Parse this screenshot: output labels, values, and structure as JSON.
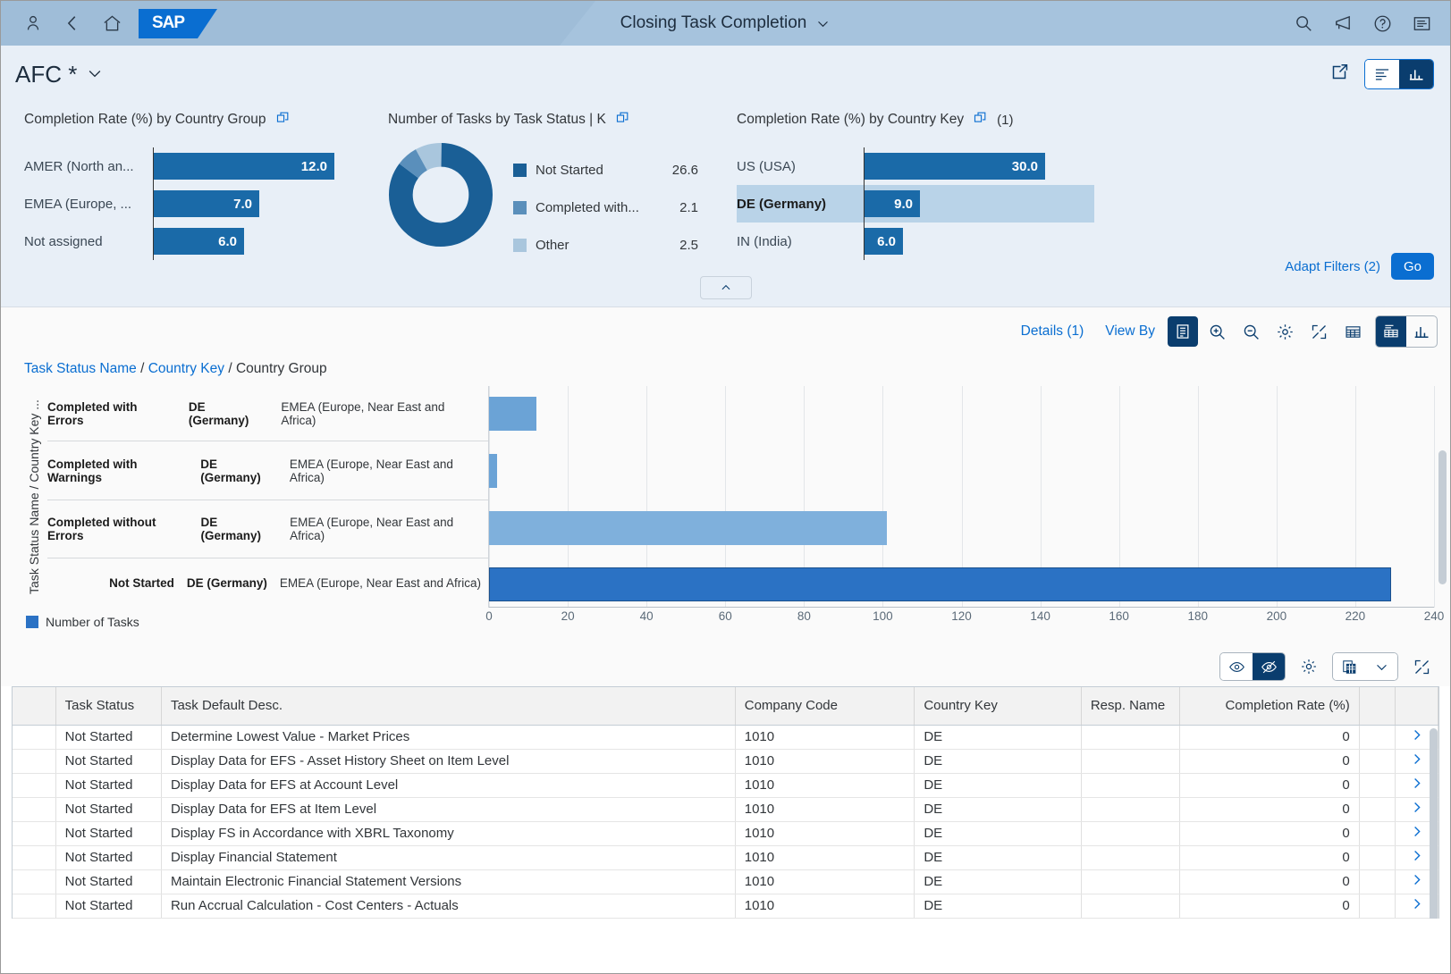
{
  "shellbar": {
    "title": "Closing Task Completion",
    "icons": [
      "user-icon",
      "back-icon",
      "home-icon",
      "sap-logo",
      "search-icon",
      "megaphone-icon",
      "help-icon",
      "menu-icon"
    ],
    "logo_text": "SAP"
  },
  "variant": {
    "name": "AFC *"
  },
  "header_actions": {
    "share_icon": "share-icon",
    "view_list_icon": "list-view-icon",
    "view_chart_icon": "chart-view-icon"
  },
  "cards": [
    {
      "title": "Completion Rate (%) by Country Group",
      "action_icon": "open-in-full-screen-icon",
      "count": "",
      "rows": [
        {
          "label": "AMER (North an...",
          "value": "12.0",
          "v": 12.0,
          "selected": false
        },
        {
          "label": "EMEA (Europe, ...",
          "value": "7.0",
          "v": 7.0,
          "selected": false
        },
        {
          "label": "Not assigned",
          "value": "6.0",
          "v": 6.0,
          "selected": false
        }
      ]
    },
    {
      "title": "Number of Tasks by Task Status  | K",
      "action_icon": "open-in-full-screen-icon",
      "count": "",
      "legend": [
        {
          "label": "Not Started",
          "value": "26.6",
          "v": 26.6,
          "color": "#1a5f96"
        },
        {
          "label": "Completed with...",
          "value": "2.1",
          "v": 2.1,
          "color": "#5a8fbb"
        },
        {
          "label": "Other",
          "value": "2.5",
          "v": 2.5,
          "color": "#a9c6dd"
        }
      ]
    },
    {
      "title": "Completion Rate (%) by Country Key",
      "action_icon": "open-in-full-screen-icon",
      "count": "(1)",
      "rows": [
        {
          "label": "US (USA)",
          "value": "30.0",
          "v": 30.0,
          "selected": false
        },
        {
          "label": "DE (Germany)",
          "value": "9.0",
          "v": 9.0,
          "selected": true
        },
        {
          "label": "IN (India)",
          "value": "6.0",
          "v": 6.0,
          "selected": false
        }
      ]
    }
  ],
  "filters": {
    "adapt_label": "Adapt Filters (2)",
    "go_label": "Go"
  },
  "chart_toolbar": {
    "details_label": "Details (1)",
    "view_by_label": "View By",
    "icons": [
      "dimension-list-icon",
      "zoom-in-icon",
      "zoom-out-icon",
      "settings-icon",
      "fullscreen-icon",
      "table-grid-icon",
      "chart-table-icon",
      "bar-chart-icon"
    ]
  },
  "breadcrumb": {
    "items": [
      "Task Status Name",
      "Country Key"
    ],
    "current": "Country Group",
    "separator": "/"
  },
  "chart_data": {
    "type": "bar",
    "orientation": "horizontal",
    "title": "",
    "ylabel": "Task Status Name / Country Key ...",
    "xlabel": "",
    "legend": [
      {
        "name": "Number of Tasks",
        "color": "#2b72c4"
      }
    ],
    "legend_position": "bottom-left",
    "grid": true,
    "xlim": [
      0,
      240
    ],
    "xticks": [
      0,
      20,
      40,
      60,
      80,
      100,
      120,
      140,
      160,
      180,
      200,
      220,
      240
    ],
    "categories": [
      {
        "status": "Completed with Errors",
        "country": "DE (Germany)",
        "group": "EMEA (Europe, Near East and Africa)"
      },
      {
        "status": "Completed with Warnings",
        "country": "DE (Germany)",
        "group": "EMEA (Europe, Near East and Africa)"
      },
      {
        "status": "Completed without Errors",
        "country": "DE (Germany)",
        "group": "EMEA (Europe, Near East and Africa)"
      },
      {
        "status": "Not Started",
        "country": "DE (Germany)",
        "group": "EMEA (Europe, Near East and Africa)"
      }
    ],
    "values": [
      12,
      2,
      101,
      229
    ],
    "bar_colors": [
      "#6ba3d6",
      "#6ba3d6",
      "#7fb0dc",
      "#2b72c4"
    ]
  },
  "chart_footer": {
    "icons": [
      "show-labels-icon",
      "hide-labels-icon",
      "settings-icon",
      "copy-to-clipboard-icon",
      "chevron-down-icon",
      "fullscreen-icon"
    ]
  },
  "table": {
    "columns": [
      "",
      "Task Status",
      "Task Default Desc.",
      "Company Code",
      "Country Key",
      "Resp. Name",
      "Completion Rate (%)",
      "",
      ""
    ],
    "rows": [
      {
        "status": "Not Started",
        "desc": "Determine Lowest Value - Market Prices",
        "company": "1010",
        "country": "DE",
        "resp": "",
        "rate": "0"
      },
      {
        "status": "Not Started",
        "desc": "Display Data for EFS - Asset History Sheet on Item Level",
        "company": "1010",
        "country": "DE",
        "resp": "",
        "rate": "0"
      },
      {
        "status": "Not Started",
        "desc": "Display Data for EFS at Account Level",
        "company": "1010",
        "country": "DE",
        "resp": "",
        "rate": "0"
      },
      {
        "status": "Not Started",
        "desc": "Display Data for EFS at Item Level",
        "company": "1010",
        "country": "DE",
        "resp": "",
        "rate": "0"
      },
      {
        "status": "Not Started",
        "desc": "Display FS in Accordance with XBRL Taxonomy",
        "company": "1010",
        "country": "DE",
        "resp": "",
        "rate": "0"
      },
      {
        "status": "Not Started",
        "desc": "Display Financial Statement",
        "company": "1010",
        "country": "DE",
        "resp": "",
        "rate": "0"
      },
      {
        "status": "Not Started",
        "desc": "Maintain Electronic Financial Statement Versions",
        "company": "1010",
        "country": "DE",
        "resp": "",
        "rate": "0"
      },
      {
        "status": "Not Started",
        "desc": "Run Accrual Calculation - Cost Centers - Actuals",
        "company": "1010",
        "country": "DE",
        "resp": "",
        "rate": "0"
      }
    ],
    "row_chevron": "navigate-icon"
  },
  "colors": {
    "brand_blue": "#0a6ed1",
    "dark_blue": "#0a3d6e",
    "bar_blue": "#1a6aa8",
    "chart_blue": "#2b72c4",
    "header_bg": "#e8eff7",
    "shell_bg": "#a6c3dd"
  }
}
